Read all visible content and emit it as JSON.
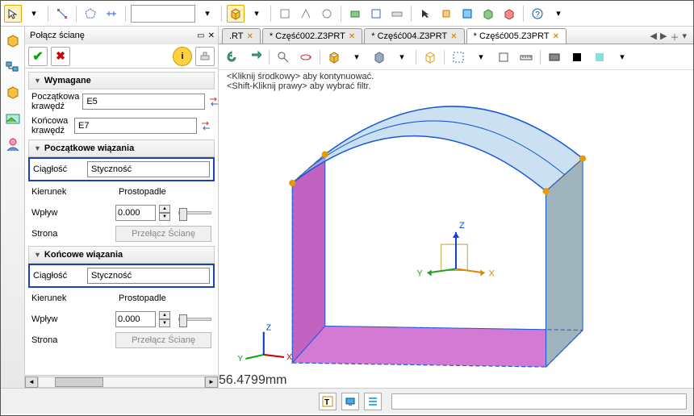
{
  "panel": {
    "title": "Połącz ścianę",
    "sections": {
      "wymagane": {
        "title": "Wymagane",
        "start_edge_label": "Początkowa krawędź",
        "start_edge_value": "E5",
        "end_edge_label": "Końcowa krawędź",
        "end_edge_value": "E7"
      },
      "start": {
        "title": "Początkowe wiązania",
        "continuity_label": "Ciągłość",
        "continuity_value": "Styczność",
        "direction_label": "Kierunek",
        "direction_value": "Prostopadle",
        "influence_label": "Wpływ",
        "influence_value": "0.000",
        "side_label": "Strona",
        "side_button": "Przełącz Ścianę"
      },
      "end": {
        "title": "Końcowe wiązania",
        "continuity_label": "Ciągłość",
        "continuity_value": "Styczność",
        "direction_label": "Kierunek",
        "direction_value": "Prostopadle",
        "influence_label": "Wpływ",
        "influence_value": "0.000",
        "side_label": "Strona",
        "side_button": "Przełącz Ścianę"
      }
    }
  },
  "tabs": {
    "t1": ".RT",
    "t2": "* Część002.Z3PRT",
    "t3": "* Część004.Z3PRT",
    "t4": "* Część005.Z3PRT"
  },
  "hints": {
    "line1": "<Kliknij środkowy> aby kontynuować.",
    "line2": "<Shift-Kliknij prawy> aby wybrać filtr."
  },
  "readout": "56.4799mm",
  "axes": {
    "x": "X",
    "y": "Y",
    "z": "Z"
  },
  "colors": {
    "highlight": "#1c3ec9",
    "surface_top": "#a9cde8",
    "surface_side1": "#c263c2",
    "surface_side2": "#9fb4bc",
    "surface_floor": "#d47ad4",
    "wire": "#1a5ad6",
    "dash": "#e69b00"
  },
  "chart_data": null
}
